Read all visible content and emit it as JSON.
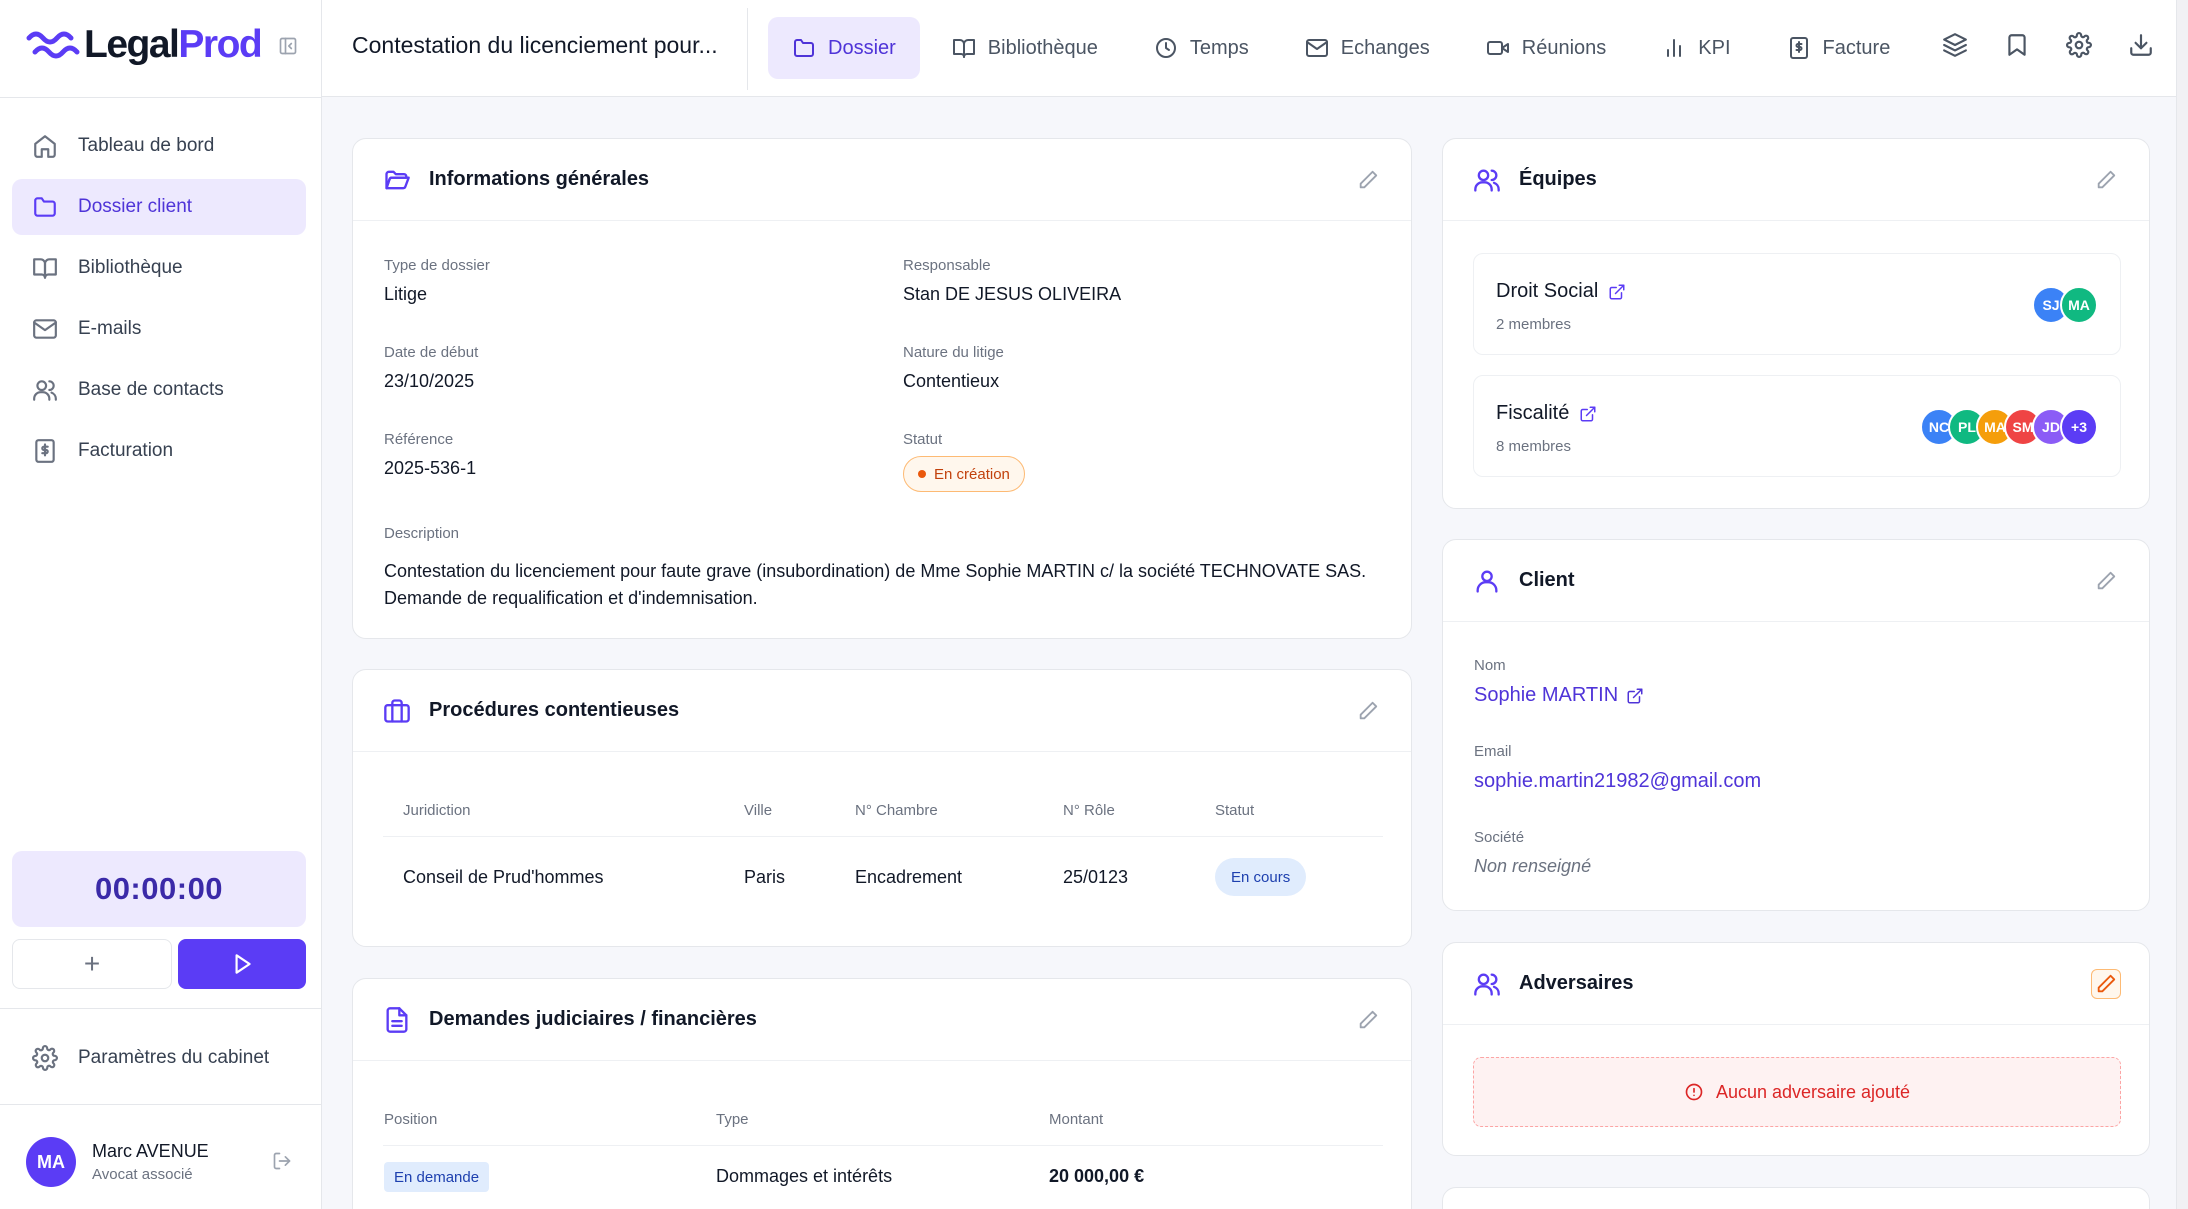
{
  "app": {
    "logo_prefix": "Legal",
    "logo_accent": "Prod"
  },
  "sidebar": {
    "items": [
      {
        "label": "Tableau de bord",
        "icon": "home-icon"
      },
      {
        "label": "Dossier client",
        "icon": "folder-icon",
        "active": true
      },
      {
        "label": "Bibliothèque",
        "icon": "book-icon"
      },
      {
        "label": "E-mails",
        "icon": "mail-icon"
      },
      {
        "label": "Base de contacts",
        "icon": "users-icon"
      },
      {
        "label": "Facturation",
        "icon": "invoice-icon"
      }
    ],
    "timer": "00:00:00",
    "timer_add": "+",
    "settings_label": "Paramètres du cabinet",
    "user": {
      "initials": "MA",
      "name": "Marc AVENUE",
      "role": "Avocat associé"
    }
  },
  "topbar": {
    "case_title": "Contestation du licenciement pour...",
    "tabs": [
      {
        "label": "Dossier",
        "icon": "folder-icon",
        "active": true
      },
      {
        "label": "Bibliothèque",
        "icon": "book-icon"
      },
      {
        "label": "Temps",
        "icon": "clock-icon"
      },
      {
        "label": "Echanges",
        "icon": "mail-icon"
      },
      {
        "label": "Réunions",
        "icon": "video-icon"
      },
      {
        "label": "KPI",
        "icon": "bar-chart-icon"
      },
      {
        "label": "Facture",
        "icon": "invoice-icon"
      }
    ]
  },
  "general": {
    "title": "Informations générales",
    "type_label": "Type de dossier",
    "type_value": "Litige",
    "responsable_label": "Responsable",
    "responsable_value": "Stan DE JESUS OLIVEIRA",
    "start_label": "Date de début",
    "start_value": "23/10/2025",
    "nature_label": "Nature du litige",
    "nature_value": "Contentieux",
    "ref_label": "Référence",
    "ref_value": "2025-536-1",
    "status_label": "Statut",
    "status_value": "En création",
    "desc_label": "Description",
    "desc_line1": "Contestation du licenciement pour faute grave (insubordination) de Mme Sophie MARTIN c/ la société TECHNOVATE SAS.",
    "desc_line2": "Demande de requalification et d'indemnisation."
  },
  "procedures": {
    "title": "Procédures contentieuses",
    "columns": [
      "Juridiction",
      "Ville",
      "N° Chambre",
      "N° Rôle",
      "Statut"
    ],
    "rows": [
      {
        "juridiction": "Conseil de Prud'hommes",
        "ville": "Paris",
        "chambre": "Encadrement",
        "role": "25/0123",
        "statut": "En cours"
      }
    ]
  },
  "demandes": {
    "title": "Demandes judiciaires / financières",
    "columns": [
      "Position",
      "Type",
      "Montant"
    ],
    "rows": [
      {
        "position": "En demande",
        "type": "Dommages et intérêts",
        "montant": "20 000,00 €"
      }
    ]
  },
  "equipes": {
    "title": "Équipes",
    "teams": [
      {
        "name": "Droit Social",
        "count": "2 membres",
        "avatars": [
          {
            "i": "SJ",
            "c": "#3b82f6"
          },
          {
            "i": "MA",
            "c": "#10b981"
          }
        ]
      },
      {
        "name": "Fiscalité",
        "count": "8 membres",
        "avatars": [
          {
            "i": "NC",
            "c": "#3b82f6"
          },
          {
            "i": "PL",
            "c": "#10b981"
          },
          {
            "i": "MA",
            "c": "#f59e0b"
          },
          {
            "i": "SM",
            "c": "#ef4444"
          },
          {
            "i": "JD",
            "c": "#8b5cf6"
          },
          {
            "i": "+3",
            "c": "#5b3cf5"
          }
        ]
      }
    ]
  },
  "client": {
    "title": "Client",
    "nom_label": "Nom",
    "nom_value": "Sophie MARTIN",
    "email_label": "Email",
    "email_value": "sophie.martin21982@gmail.com",
    "societe_label": "Société",
    "societe_value": "Non renseigné"
  },
  "adversaires": {
    "title": "Adversaires",
    "empty": "Aucun adversaire ajouté"
  },
  "colors": {
    "accent": "#5b3cf5",
    "accent_bg": "#ede9fe",
    "warning": "#ea580c",
    "danger": "#dc2626"
  }
}
